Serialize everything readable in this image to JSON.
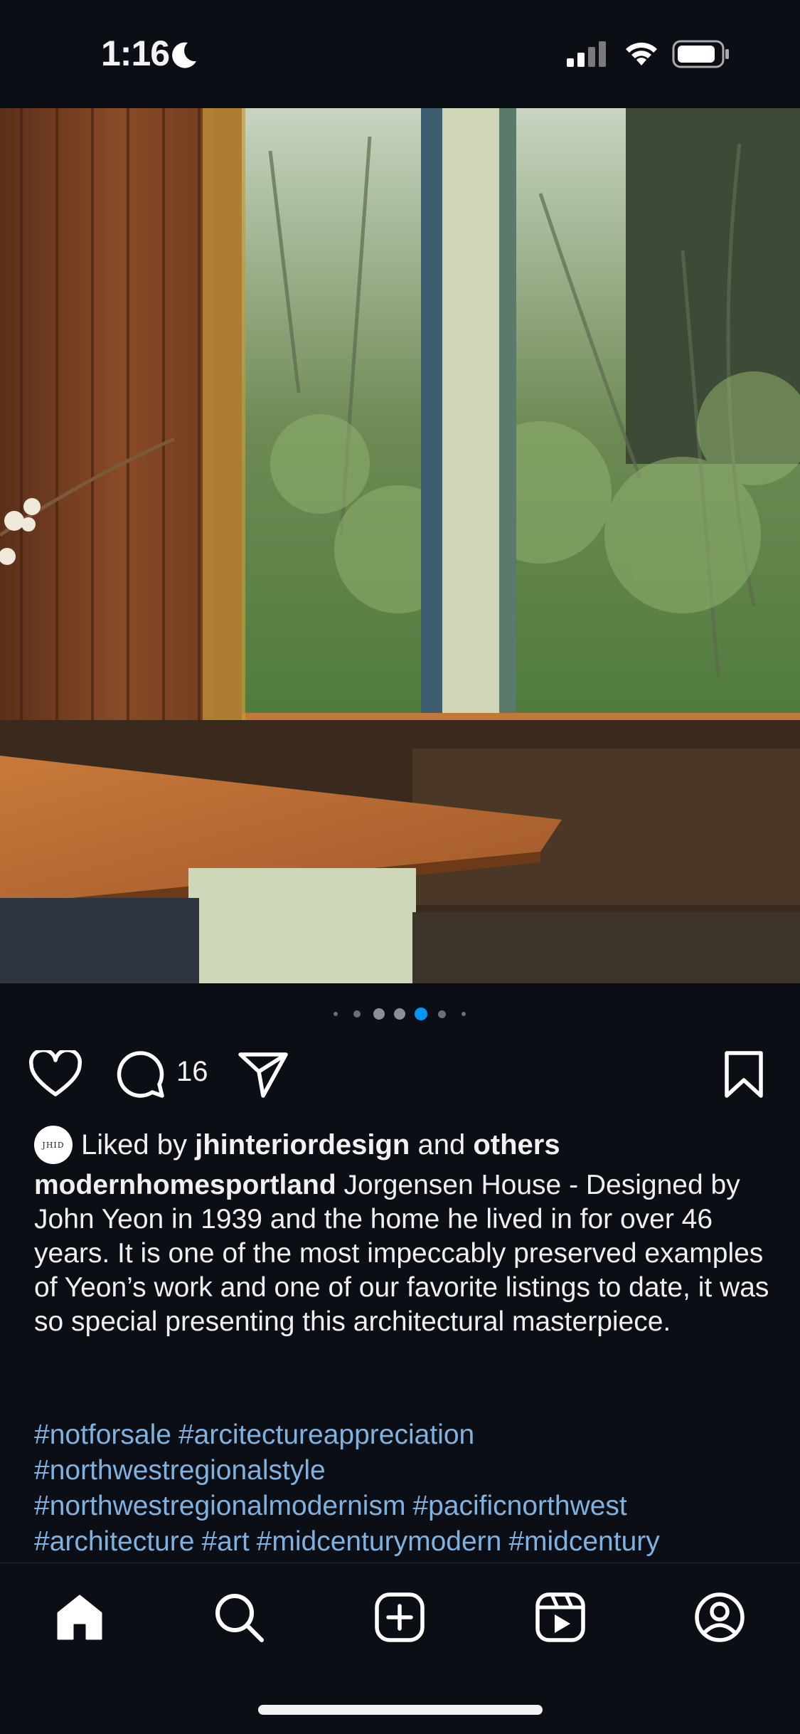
{
  "status_bar": {
    "time": "1:16",
    "icons": [
      "moon-icon",
      "cellular-signal-icon",
      "wifi-icon",
      "battery-icon"
    ]
  },
  "post": {
    "image_description_icon": "photo",
    "carousel": {
      "total_dots": 7,
      "active_index": 4
    },
    "comment_count": "16",
    "liked_by": {
      "prefix": "Liked by",
      "user": "jhinteriordesign",
      "middle": "and",
      "others": "others",
      "avatar_text": "JHID"
    },
    "caption": {
      "username": "modernhomesportland",
      "text": " Jorgensen House - Designed by John Yeon in 1939 and the home he lived in for over 46 years. It is one of the most impeccably preserved examples of Yeon’s work and one of our favorite listings to date, it was so special presenting this architectural masterpiece."
    },
    "hashtags": [
      "#notforsale",
      "#arcitectureappreciation",
      "#northwestregionalstyle",
      "#northwestregionalmodernism",
      "#pacificnorthwest",
      "#architecture",
      "#art",
      "#midcenturymodern",
      "#midcentury"
    ]
  },
  "nav": {
    "items": [
      "home-icon",
      "search-icon",
      "create-icon",
      "reels-icon",
      "profile-icon"
    ]
  },
  "colors": {
    "background": "#0b0e14",
    "accent_blue": "#0095f6",
    "hashtag": "#7fb2e0"
  }
}
